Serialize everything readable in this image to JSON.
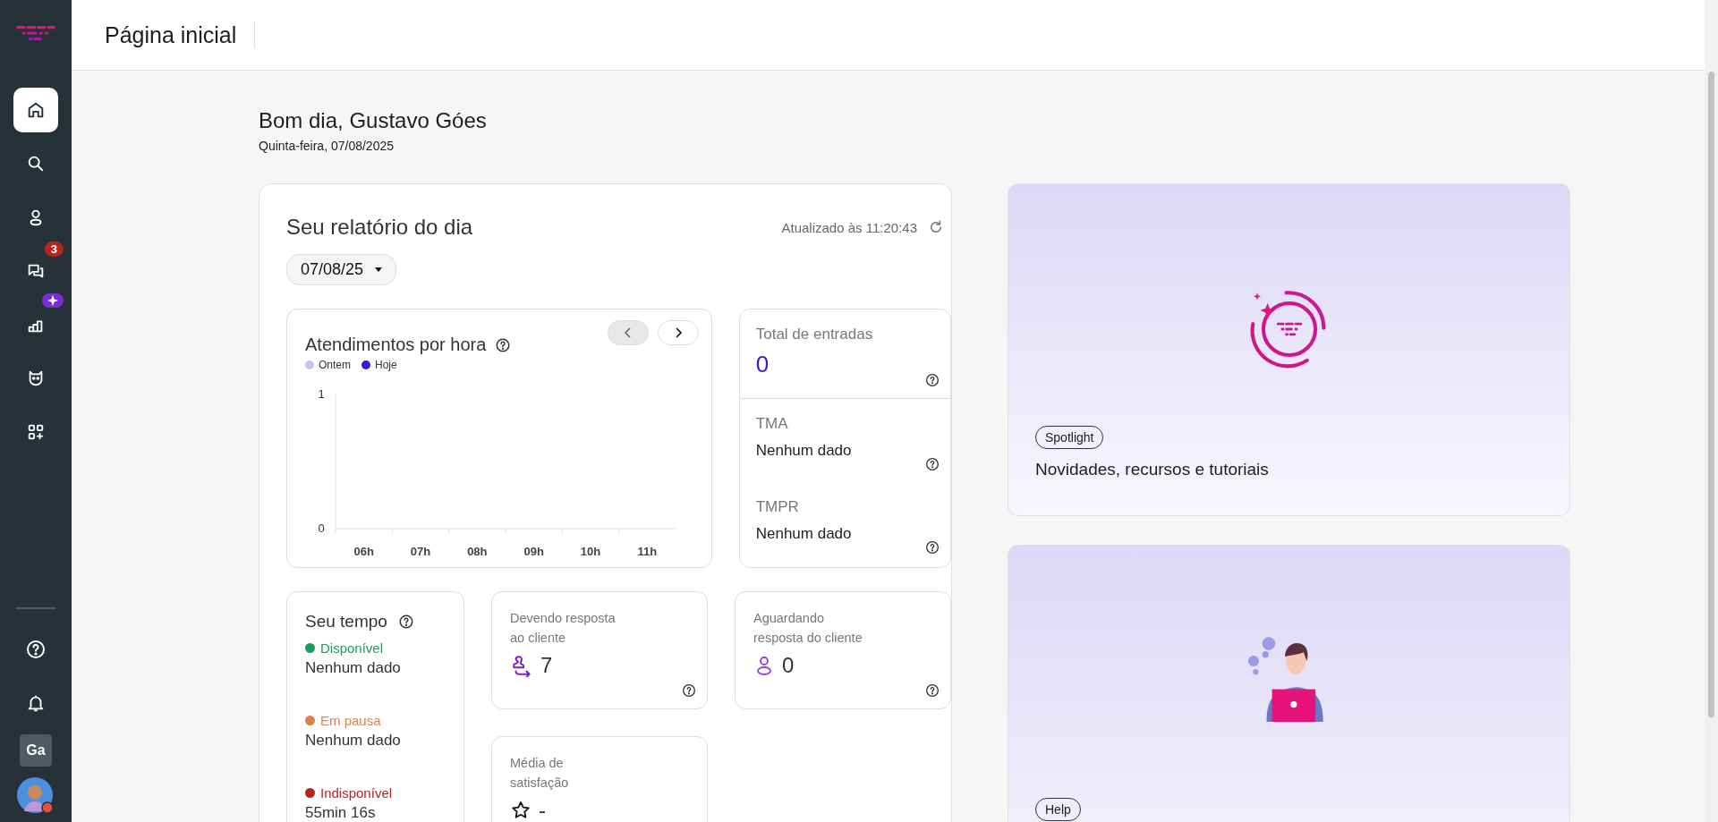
{
  "sidebar": {
    "nav_items": [
      {
        "selected": true
      },
      {
        "selected": false
      },
      {
        "selected": false
      },
      {
        "selected": false,
        "badge": "3"
      },
      {
        "selected": false
      },
      {
        "selected": false
      },
      {
        "selected": false
      }
    ],
    "account_initials": "Ga"
  },
  "header": {
    "title": "Página inicial"
  },
  "greeting": {
    "title": "Bom dia, Gustavo Góes",
    "date": "Quinta-feira, 07/08/2025"
  },
  "report": {
    "title": "Seu relatório do dia",
    "updated": "Atualizado às 11:20:43",
    "date_select": "07/08/25",
    "hourly": {
      "title": "Atendimentos por hora",
      "chart_data": {
        "type": "line",
        "categories": [
          "06h",
          "07h",
          "08h",
          "09h",
          "10h",
          "11h"
        ],
        "yticks": [
          0,
          1
        ],
        "ylim": [
          0,
          1
        ],
        "series": [
          {
            "name": "Ontem",
            "color": "#c9c3f3",
            "values": [
              null,
              null,
              null,
              null,
              null,
              null
            ]
          },
          {
            "name": "Hoje",
            "color": "#3b17d8",
            "values": [
              null,
              null,
              null,
              null,
              null,
              null
            ]
          }
        ]
      }
    },
    "stats": [
      {
        "label": "Total de entradas",
        "value": "0",
        "kind": "highlight"
      },
      {
        "label": "TMA",
        "value": "Nenhum dado",
        "kind": "plain"
      },
      {
        "label": "TMPR",
        "value": "Nenhum dado",
        "kind": "plain"
      }
    ],
    "time": {
      "title": "Seu tempo",
      "statuses": [
        {
          "label": "Disponível",
          "color": "#1a9e5c",
          "value": "Nenhum dado"
        },
        {
          "label": "Em pausa",
          "color": "#d9814f",
          "value": "Nenhum dado"
        },
        {
          "label": "Indisponível",
          "color": "#b3261e",
          "value": "55min 16s"
        }
      ]
    },
    "counters": [
      {
        "label": "Devendo resposta ao cliente",
        "value": "7"
      },
      {
        "label": "Aguardando resposta do cliente",
        "value": "0"
      },
      {
        "label": "Média de satisfação",
        "value": "-"
      }
    ]
  },
  "promos": [
    {
      "kind": "spotlight",
      "tag": "Spotlight",
      "text": "Novidades, recursos e tutoriais"
    },
    {
      "kind": "help",
      "tag": "Help"
    }
  ]
}
